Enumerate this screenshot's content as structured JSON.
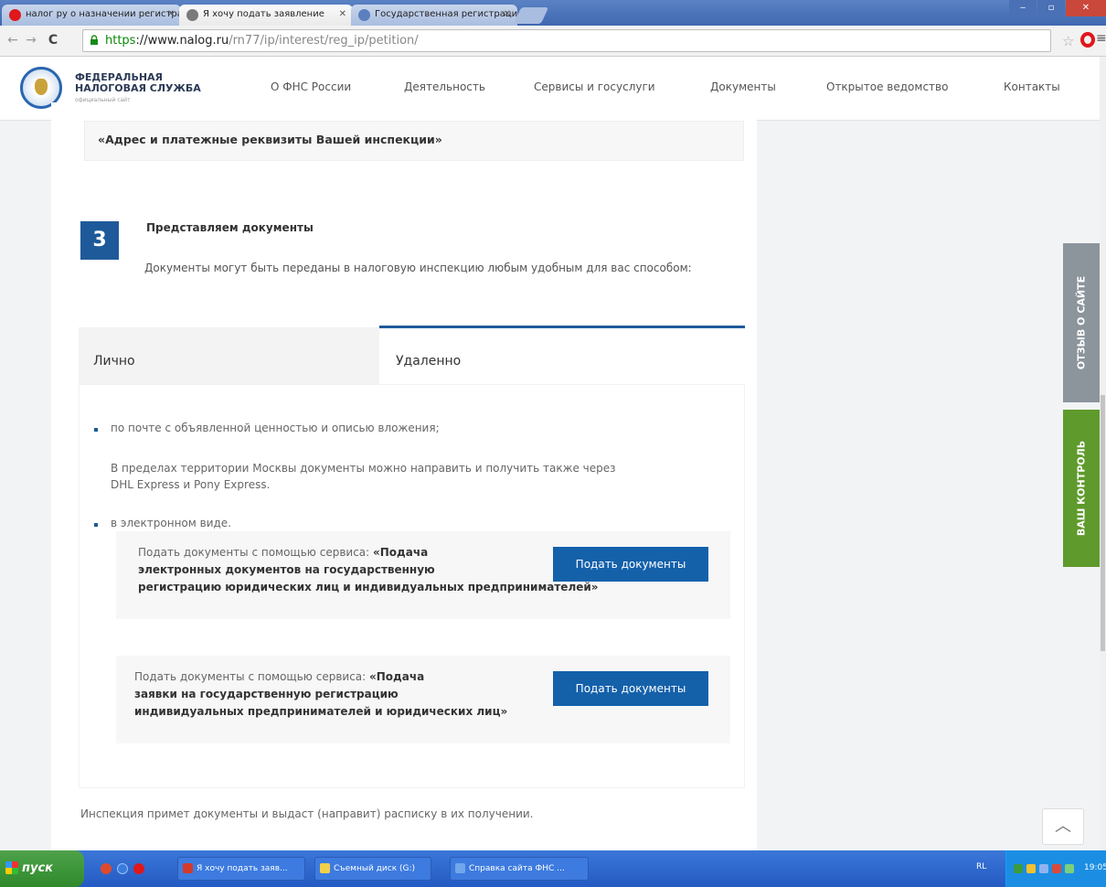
{
  "browser": {
    "tabs": [
      {
        "title": "налог ру о назначении регистрации",
        "favicon_color": "#e0171b"
      },
      {
        "title": "Я хочу подать заявление",
        "favicon_color": "#7a7a7a"
      },
      {
        "title": "Государственная регистрация",
        "favicon_color": "#5b7fbf"
      }
    ],
    "tab_close": "✕",
    "window_controls": {
      "minimize": "‒",
      "maximize": "▫",
      "close": "✕"
    },
    "nav": {
      "back": "←",
      "forward": "→",
      "reload": "C"
    },
    "url": {
      "scheme": "https",
      "host": "://www.nalog.ru",
      "path": "/rn77/ip/interest/reg_ip/petition/"
    },
    "star": "☆",
    "menu": "≡"
  },
  "site": {
    "logo_line1": "ФЕДЕРАЛЬНАЯ",
    "logo_line2": "НАЛОГОВАЯ СЛУЖБА",
    "logo_sub": "официальный сайт",
    "nav": [
      "О ФНС России",
      "Деятельность",
      "Сервисы и госуслуги",
      "Документы",
      "Открытое ведомство",
      "Контакты"
    ]
  },
  "step2": {
    "address_text": "«Адрес и платежные реквизиты Вашей инспекции»"
  },
  "step3": {
    "number": "3",
    "title": "Представляем документы",
    "description": "Документы могут быть переданы в налоговую инспекцию любым удобным для вас способом:",
    "tabs": {
      "personal": "Лично",
      "remote": "Удаленно"
    },
    "bullet_mail": "по почте с объявленной ценностью и описью вложения;",
    "moscow_note_line1": "В пределах территории Москвы документы можно направить и получить также через",
    "moscow_note_line2": "DHL Express и Pony Express.",
    "bullet_electronic": "в электронном виде.",
    "service1": {
      "prefix": "Подать документы с помощью сервиса: ",
      "name_line1": "«Подача",
      "name_line2": "электронных документов на государственную",
      "name_line3": "регистрацию юридических лиц и индивидуальных предпринимателей»",
      "button": "Подать документы"
    },
    "service2": {
      "prefix": "Подать документы с помощью сервиса: ",
      "name_line1": "«Подача",
      "name_line2": "заявки на государственную регистрацию",
      "name_line3": "индивидуальных предпринимателей и юридических лиц»",
      "button": "Подать документы"
    },
    "footer": "Инспекция примет документы и выдаст (направит) расписку в их получении."
  },
  "side": {
    "feedback": "ОТЗЫВ О САЙТЕ",
    "control": "ВАШ КОНТРОЛЬ",
    "to_top": "︿"
  },
  "taskbar": {
    "start": "пуск",
    "tasks": [
      {
        "label": "Я хочу подать заяв...",
        "color": "#d33a2c"
      },
      {
        "label": "Съемный диск (G:)",
        "color": "#f3d04a"
      },
      {
        "label": "Справка сайта ФНС ...",
        "color": "#6fa7ea"
      }
    ],
    "lang": "RL",
    "clock": "19:05"
  }
}
